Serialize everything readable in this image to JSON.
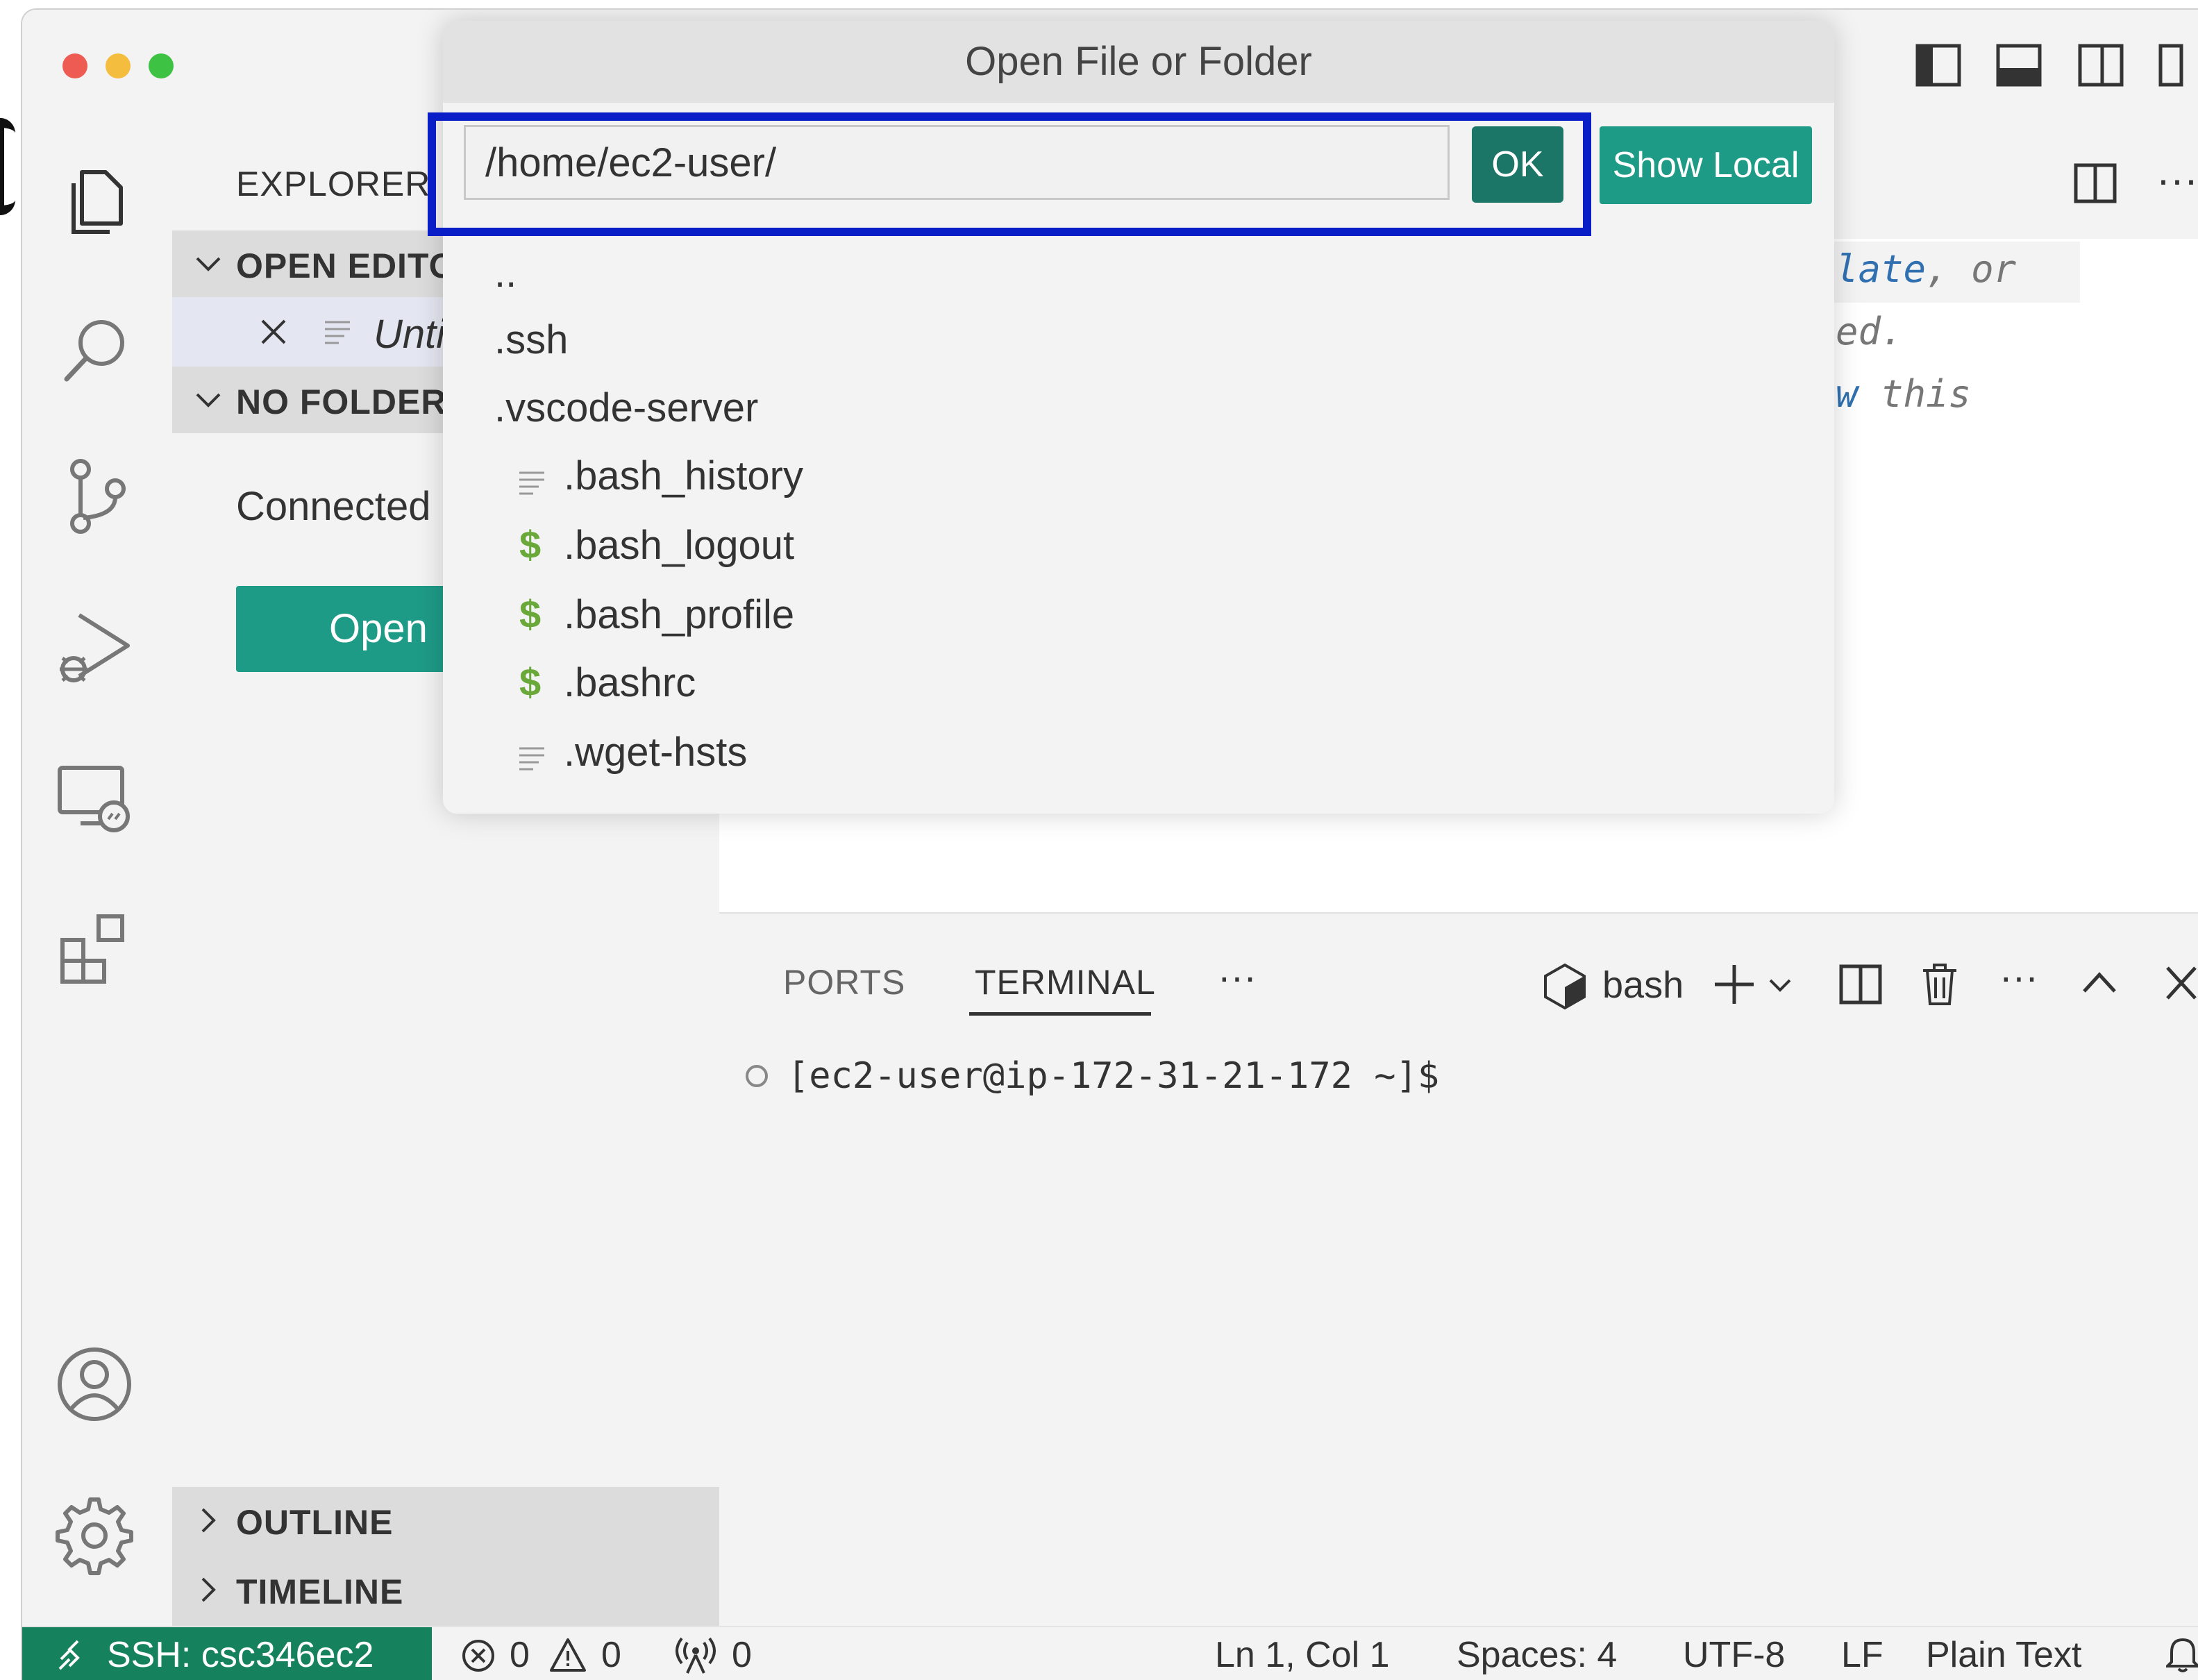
{
  "sidebar": {
    "title": "EXPLORER",
    "open_editors": "OPEN EDITO",
    "open_editor_file": "Unti",
    "no_folder": "NO FOLDER",
    "connected_text": "Connected",
    "open_button": "Open",
    "outline": "OUTLINE",
    "timeline": "TIMELINE"
  },
  "editor": {
    "line1a": "late",
    "line1b": ", or",
    "line2": "ed.",
    "line3a": "w",
    "line3b": " this"
  },
  "dialog": {
    "title": "Open File or Folder",
    "input_value": "/home/ec2-user/",
    "ok_label": "OK",
    "show_local_label": "Show Local",
    "items": [
      {
        "name": "..",
        "icon": "none"
      },
      {
        "name": ".ssh",
        "icon": "none"
      },
      {
        "name": ".vscode-server",
        "icon": "none"
      },
      {
        "name": ".bash_history",
        "icon": "text-file-icon"
      },
      {
        "name": ".bash_logout",
        "icon": "dollar-icon"
      },
      {
        "name": ".bash_profile",
        "icon": "dollar-icon"
      },
      {
        "name": ".bashrc",
        "icon": "dollar-icon"
      },
      {
        "name": ".wget-hsts",
        "icon": "text-file-icon"
      }
    ],
    "highlight_color": "#0a1ec8"
  },
  "panel": {
    "tab_ports": "PORTS",
    "tab_terminal": "TERMINAL",
    "more": "···",
    "shell": "bash",
    "prompt": "[ec2-user@ip-172-31-21-172 ~]$"
  },
  "status": {
    "ssh": "SSH: csc346ec2",
    "errors": "0",
    "warnings": "0",
    "ports": "0",
    "position": "Ln 1, Col 1",
    "spaces": "Spaces: 4",
    "encoding": "UTF-8",
    "eol": "LF",
    "language": "Plain Text"
  },
  "colors": {
    "accent": "#16825d",
    "ok_button": "#1c7668",
    "show_local": "#1e9b87"
  }
}
